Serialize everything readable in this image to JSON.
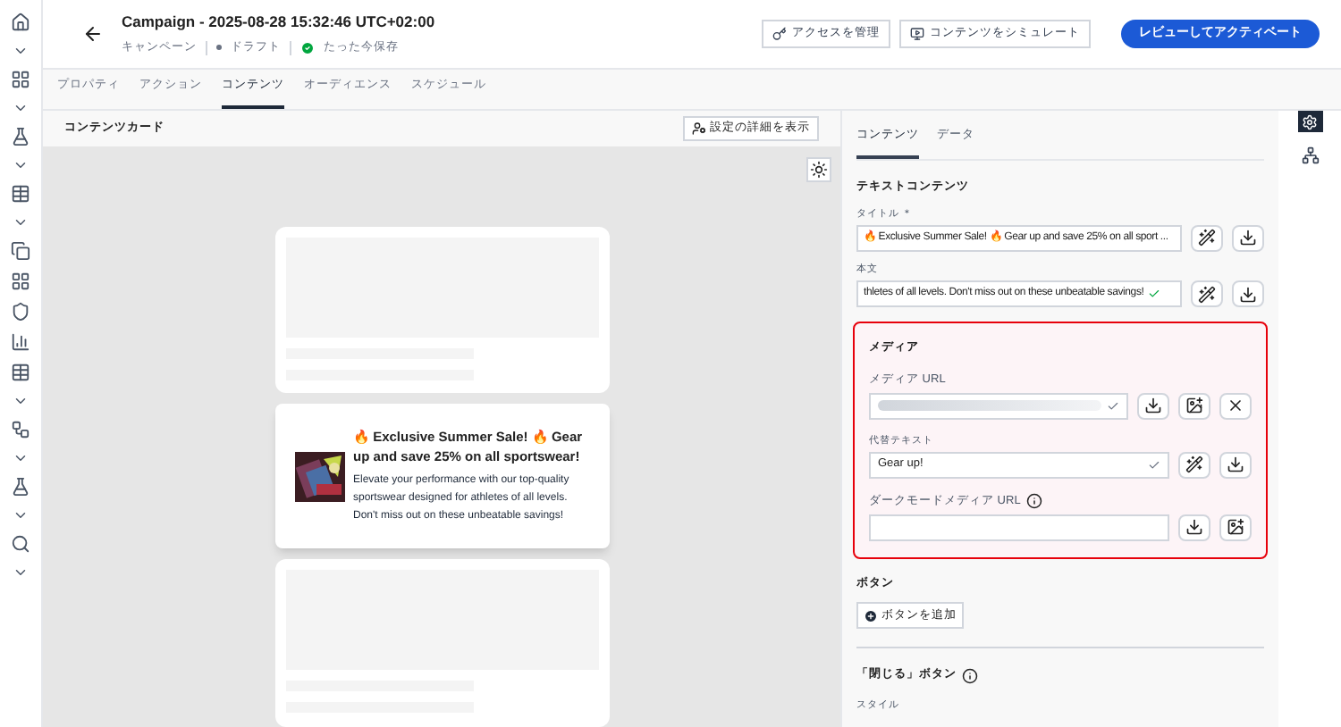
{
  "header": {
    "title": "Campaign - 2025-08-28 15:32:46 UTC+02:00",
    "breadcrumb": "キャンペーン",
    "status": "ドラフト",
    "saved": "たった今保存",
    "buttons": [
      {
        "kind": "access",
        "label": "アクセスを管理"
      },
      {
        "kind": "simulate",
        "label": "コンテンツをシミュレート"
      },
      {
        "kind": "primary",
        "label": "レビューしてアクティベート"
      }
    ]
  },
  "tabs": [
    {
      "label": "プロパティ",
      "selected": false
    },
    {
      "label": "アクション",
      "selected": false
    },
    {
      "label": "コンテンツ",
      "selected": true
    },
    {
      "label": "オーディエンス",
      "selected": false
    },
    {
      "label": "スケジュール",
      "selected": false
    }
  ],
  "canvas": {
    "title": "コンテンツカード",
    "details_button": "設定の詳細を表示",
    "card": {
      "title": "🔥 Exclusive Summer Sale! 🔥 Gear up and save 25% on all sportswear!",
      "body": "Elevate your performance with our top-quality sportswear designed for athletes of all levels. Don't miss out on these unbeatable savings!"
    }
  },
  "panel": {
    "tabs": [
      {
        "label": "コンテンツ",
        "selected": true
      },
      {
        "label": "データ",
        "selected": false
      }
    ],
    "text_section": "テキストコンテンツ",
    "fields": [
      {
        "label": "タイトル ＊",
        "value": "🔥 Exclusive Summer Sale! 🔥 Gear up and save 25% on all sport ...",
        "valid": false
      },
      {
        "label": "本文",
        "value": "thletes of all levels. Don't miss out on these unbeatable savings!",
        "valid": true
      }
    ],
    "media": {
      "title": "メディア",
      "url_label": "メディア URL",
      "alt_label": "代替テキスト",
      "alt_value": "Gear up!",
      "dark_label": "ダークモードメディア URL"
    },
    "buttons_section": "ボタン",
    "add_button": "ボタンを追加",
    "close_section": "「閉じる」ボタン",
    "style_label": "スタイル"
  }
}
